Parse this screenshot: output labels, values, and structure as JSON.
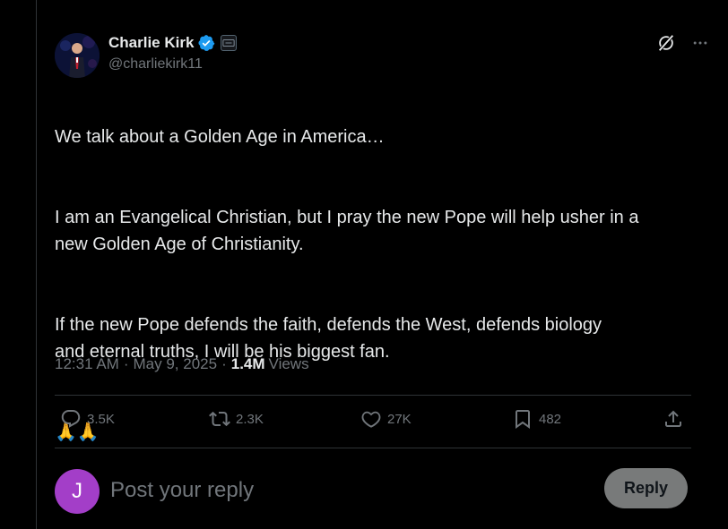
{
  "author": {
    "display_name": "Charlie Kirk",
    "handle": "@charliekirk11",
    "verified_color": "#1d9bf0"
  },
  "post": {
    "paragraphs": [
      "We talk about a Golden Age in America…",
      "I am an Evangelical Christian, but I pray the new Pope will help usher in a\nnew Golden Age of Christianity.",
      "If the new Pope defends the faith, defends the West, defends biology\nand eternal truths, I will be his biggest fan.",
      "🙏🙏"
    ],
    "time": "12:31 AM",
    "date": "May 9, 2025",
    "views_count": "1.4M",
    "views_label": "Views"
  },
  "actions": {
    "replies": "3.5K",
    "reposts": "2.3K",
    "likes": "27K",
    "bookmarks": "482"
  },
  "icons": {
    "grok": "grok-icon",
    "more": "more-icon",
    "reply": "reply-icon",
    "repost": "repost-icon",
    "like": "heart-icon",
    "bookmark": "bookmark-icon",
    "share": "share-icon"
  },
  "reply_box": {
    "avatar_letter": "J",
    "avatar_color": "#a33ec8",
    "placeholder": "Post your reply",
    "button_label": "Reply"
  }
}
